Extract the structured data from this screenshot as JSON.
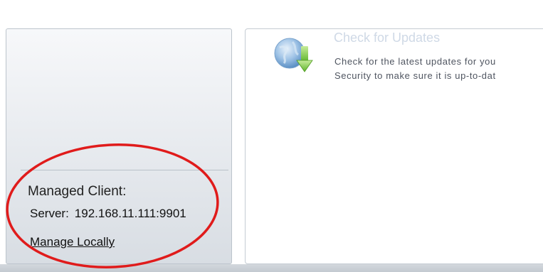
{
  "update_panel": {
    "title": "Check for Updates",
    "description_line1": "Check for the latest updates for you",
    "description_line2": "Security to make sure it is up-to-dat",
    "icon": "globe-download-icon"
  },
  "sidebar": {
    "managed_heading": "Managed Client:",
    "server_label": "Server:",
    "server_value": "192.168.11.111:9901",
    "manage_link": "Manage Locally"
  },
  "annotation": {
    "color": "#e01b1b"
  }
}
